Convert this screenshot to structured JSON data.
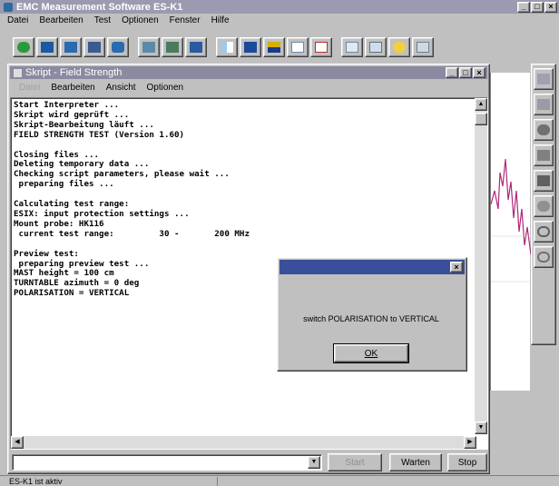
{
  "app": {
    "title": "EMC Measurement Software ES-K1",
    "menu": [
      "Datei",
      "Bearbeiten",
      "Test",
      "Optionen",
      "Fenster",
      "Hilfe"
    ],
    "toolbar_icons": [
      "new-test-icon",
      "open-file-icon",
      "save-icon",
      "print-icon",
      "run-icon",
      "copy-icon",
      "probe-icon",
      "monitor-icon",
      "bar-chart-icon",
      "spectrum-icon",
      "graph-icon",
      "table-icon",
      "layout-icon",
      "help-icon",
      "report-icon"
    ],
    "right_toolbar_icons": [
      "data-icon",
      "list-icon",
      "dish-icon",
      "antenna-icon",
      "tower-icon",
      "turntable-icon",
      "target-icon",
      "reset-icon"
    ],
    "status": "ES-K1 ist aktiv"
  },
  "child_window": {
    "title": "Skript - Field Strength",
    "menu": [
      "Datei",
      "Bearbeiten",
      "Ansicht",
      "Optionen"
    ],
    "log": [
      "Start Interpreter ...",
      "Skript wird geprüft ...",
      "Skript-Bearbeitung läuft ...",
      "FIELD STRENGTH TEST (Version 1.60)",
      "",
      "Closing files ...",
      "Deleting temporary data ...",
      "Checking script parameters, please wait ...",
      " preparing files ...",
      "",
      "Calculating test range:",
      "ESIX: input protection settings ...",
      "Mount probe: HK116",
      " current test range:         30 -       200 MHz",
      "",
      "Preview test:",
      " preparing preview test ...",
      "MAST height = 100 cm",
      "TURNTABLE azimuth = 0 deg",
      "POLARISATION = VERTICAL"
    ],
    "buttons": {
      "start": "Start",
      "wait": "Warten",
      "stop": "Stop"
    }
  },
  "dialog": {
    "message": "switch POLARISATION to VERTICAL",
    "ok_label": "OK"
  },
  "colors": {
    "active_title": "#3a4f9a",
    "inactive_title": "#8a8aa0",
    "plot_trace": "#b02878"
  }
}
